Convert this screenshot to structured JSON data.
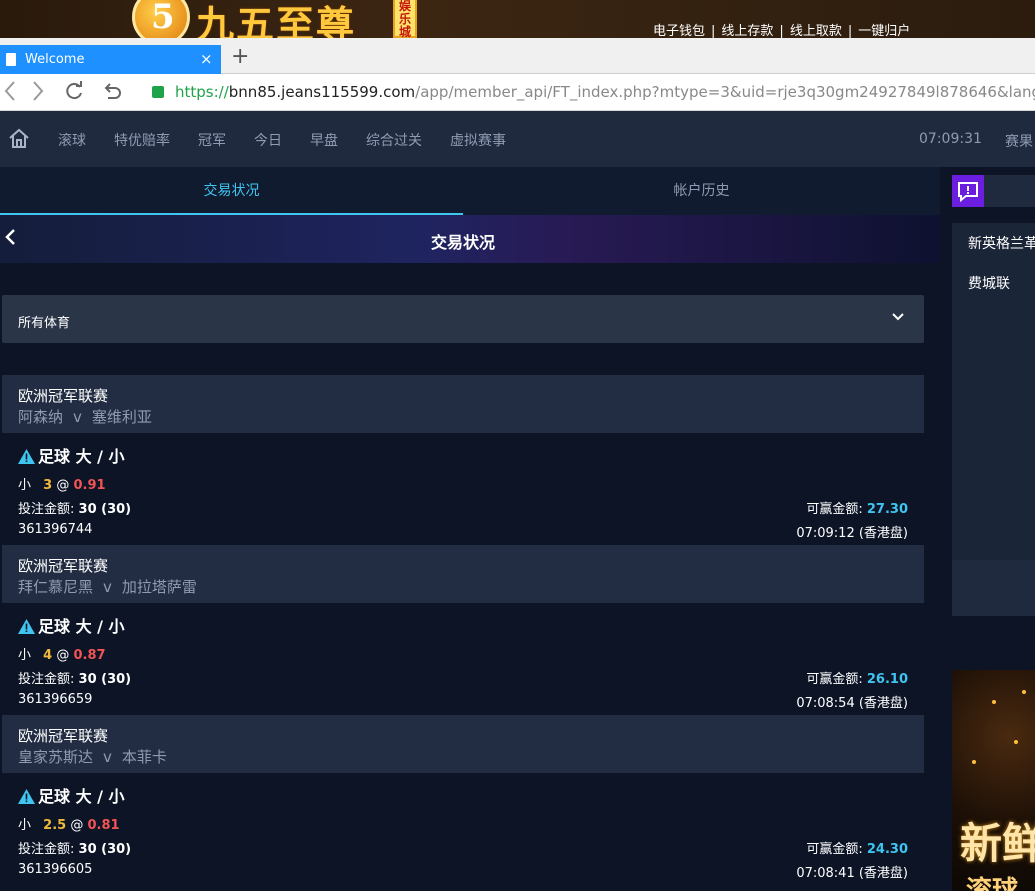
{
  "banner": {
    "logo_number": "5",
    "logo_text": "九五至尊",
    "logo_tag": "娱乐城",
    "links": [
      "电子钱包",
      "线上存款",
      "线上取款",
      "一键归户"
    ],
    "separator": "|"
  },
  "browser": {
    "tab_title": "Welcome",
    "tab_close": "×",
    "new_tab": "+",
    "url_scheme": "https://",
    "url_host": "bnn85.jeans115599.com",
    "url_path": "/app/member_api/FT_index.php?mtype=3&uid=rje3q30gm24927849l878646&langx=zh-cn&new"
  },
  "sitenav": {
    "items": [
      "滚球",
      "特优赔率",
      "冠军",
      "今日",
      "早盘",
      "综合过关",
      "虚拟赛事"
    ],
    "clock": "07:09:31",
    "results": "赛果"
  },
  "main": {
    "tabs": [
      "交易状况",
      "帐户历史"
    ],
    "page_title": "交易状况",
    "sport_filter": "所有体育",
    "bets": [
      {
        "league": "欧洲冠军联赛",
        "home": "阿森纳",
        "vs": "v",
        "away": "塞维利亚",
        "market": "足球 大 / 小",
        "pick": "小",
        "line": "3",
        "at": "@",
        "odds": "0.91",
        "stake_label": "投注金额:",
        "stake": "30 (30)",
        "win_label": "可赢金额:",
        "win": "27.30",
        "ticket": "361396744",
        "time": "07:09:12 (香港盘)"
      },
      {
        "league": "欧洲冠军联赛",
        "home": "拜仁慕尼黑",
        "vs": "v",
        "away": "加拉塔萨雷",
        "market": "足球 大 / 小",
        "pick": "小",
        "line": "4",
        "at": "@",
        "odds": "0.87",
        "stake_label": "投注金额:",
        "stake": "30 (30)",
        "win_label": "可赢金额:",
        "win": "26.10",
        "ticket": "361396659",
        "time": "07:08:54 (香港盘)"
      },
      {
        "league": "欧洲冠军联赛",
        "home": "皇家苏斯达",
        "vs": "v",
        "away": "本菲卡",
        "market": "足球 大 / 小",
        "pick": "小",
        "line": "2.5",
        "at": "@",
        "odds": "0.81",
        "stake_label": "投注金额:",
        "stake": "30 (30)",
        "win_label": "可赢金额:",
        "win": "24.30",
        "ticket": "361396605",
        "time": "07:08:41 (香港盘)"
      }
    ]
  },
  "right": {
    "live_line1": "新英格兰革",
    "live_line2": "费城联",
    "promo_line1": "新鲜",
    "promo_line2": "滚球"
  },
  "colors": {
    "accent": "#3fc5f0",
    "odds": "#f05454",
    "line": "#f0b93a",
    "chat": "#6b1ee0"
  }
}
